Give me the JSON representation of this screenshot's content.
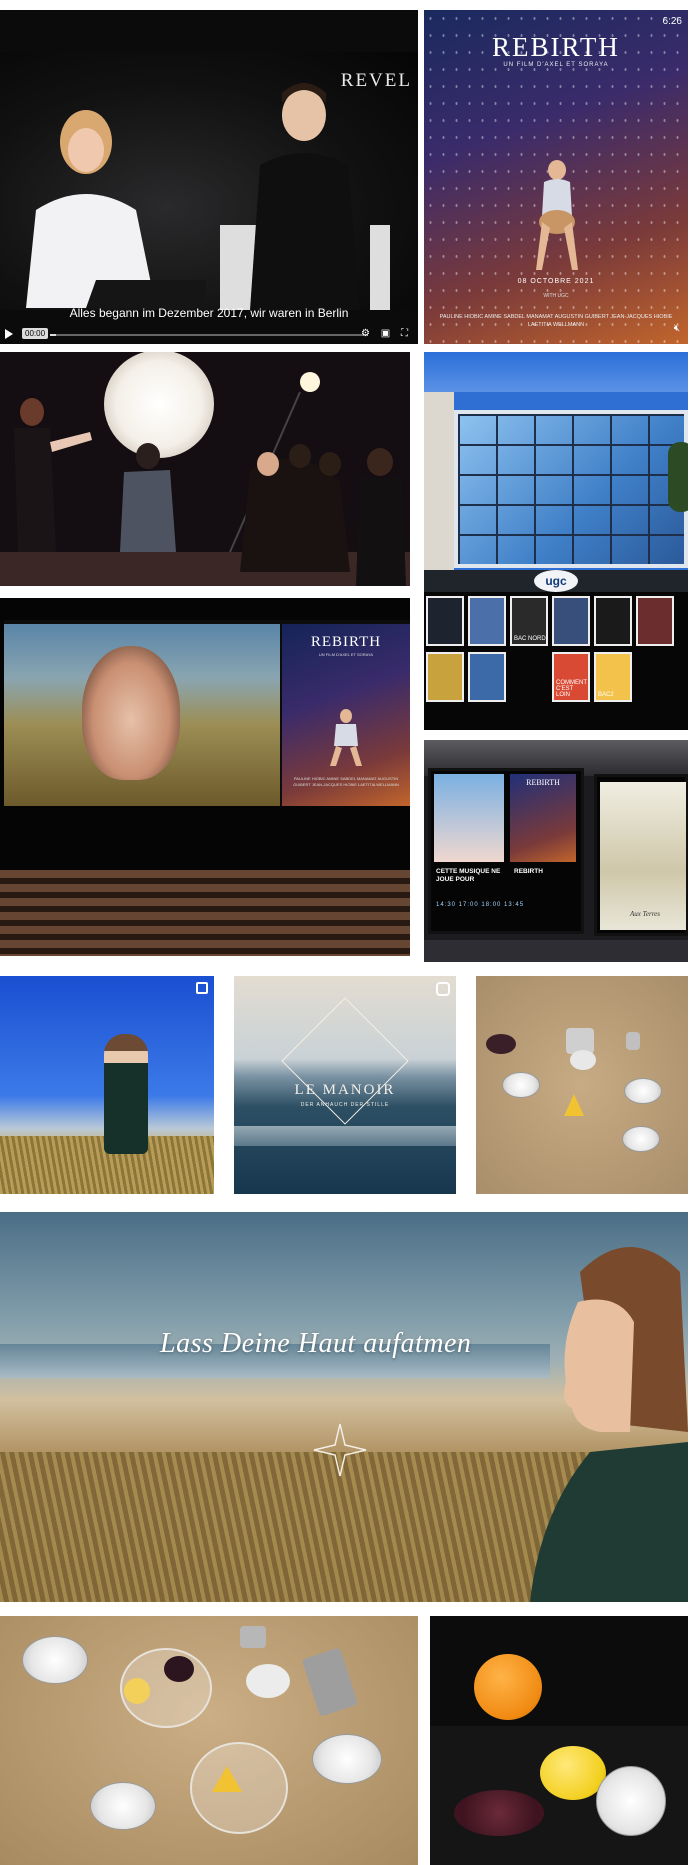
{
  "video": {
    "brand": "REVEL",
    "subtitle": "Alles begann im Dezember 2017, wir waren in Berlin",
    "time": "00:00",
    "progress": 0.02
  },
  "poster": {
    "clock": "6:26",
    "title": "REBIRTH",
    "subtitle": "UN FILM D'AXEL ET SORAYA",
    "date": "08 OCTOBRE 2021",
    "with": "WITH",
    "with_logo": "UGC",
    "cast": "PAULINE HIOBIC  AMINE SABDEL MANAMAT  AUGUSTIN GUIBERT  JEAN-JACQUES HIOBIE  LAETITIA WELLMANN"
  },
  "ugc": {
    "logo": "ugc",
    "posters": [
      "",
      "",
      "BAC NORD",
      "",
      "",
      "",
      "",
      "",
      "COMMENT C'EST LOIN",
      "BAC2"
    ]
  },
  "cinema": {
    "title": "REBIRTH",
    "subtitle": "UN FILM D'AXEL ET SORAYA",
    "cast": "PAULINE HIOBIC  AMINE SABDEL MANAMAT  AUGUSTIN GUIBERT  JEAN-JACQUES HIOBIE  LAETITIA WELLMANN"
  },
  "screens": {
    "poster_b_title": "REBIRTH",
    "caption_a": "CETTE MUSIQUE NE JOUE POUR",
    "caption_b": "REBIRTH",
    "times": "14:30  17:00  18:00      13:45",
    "caption_c": "Aux Terres"
  },
  "manoir": {
    "brand": "LE MANOIR",
    "tagline": "DER ANHAUCH DER STILLE"
  },
  "banner": {
    "slogan": "Lass Deine Haut aufatmen"
  },
  "icons": {
    "multi": "multi-image-icon",
    "reel": "reel-icon",
    "star": "compass-star-icon",
    "mute": "mute-icon"
  }
}
